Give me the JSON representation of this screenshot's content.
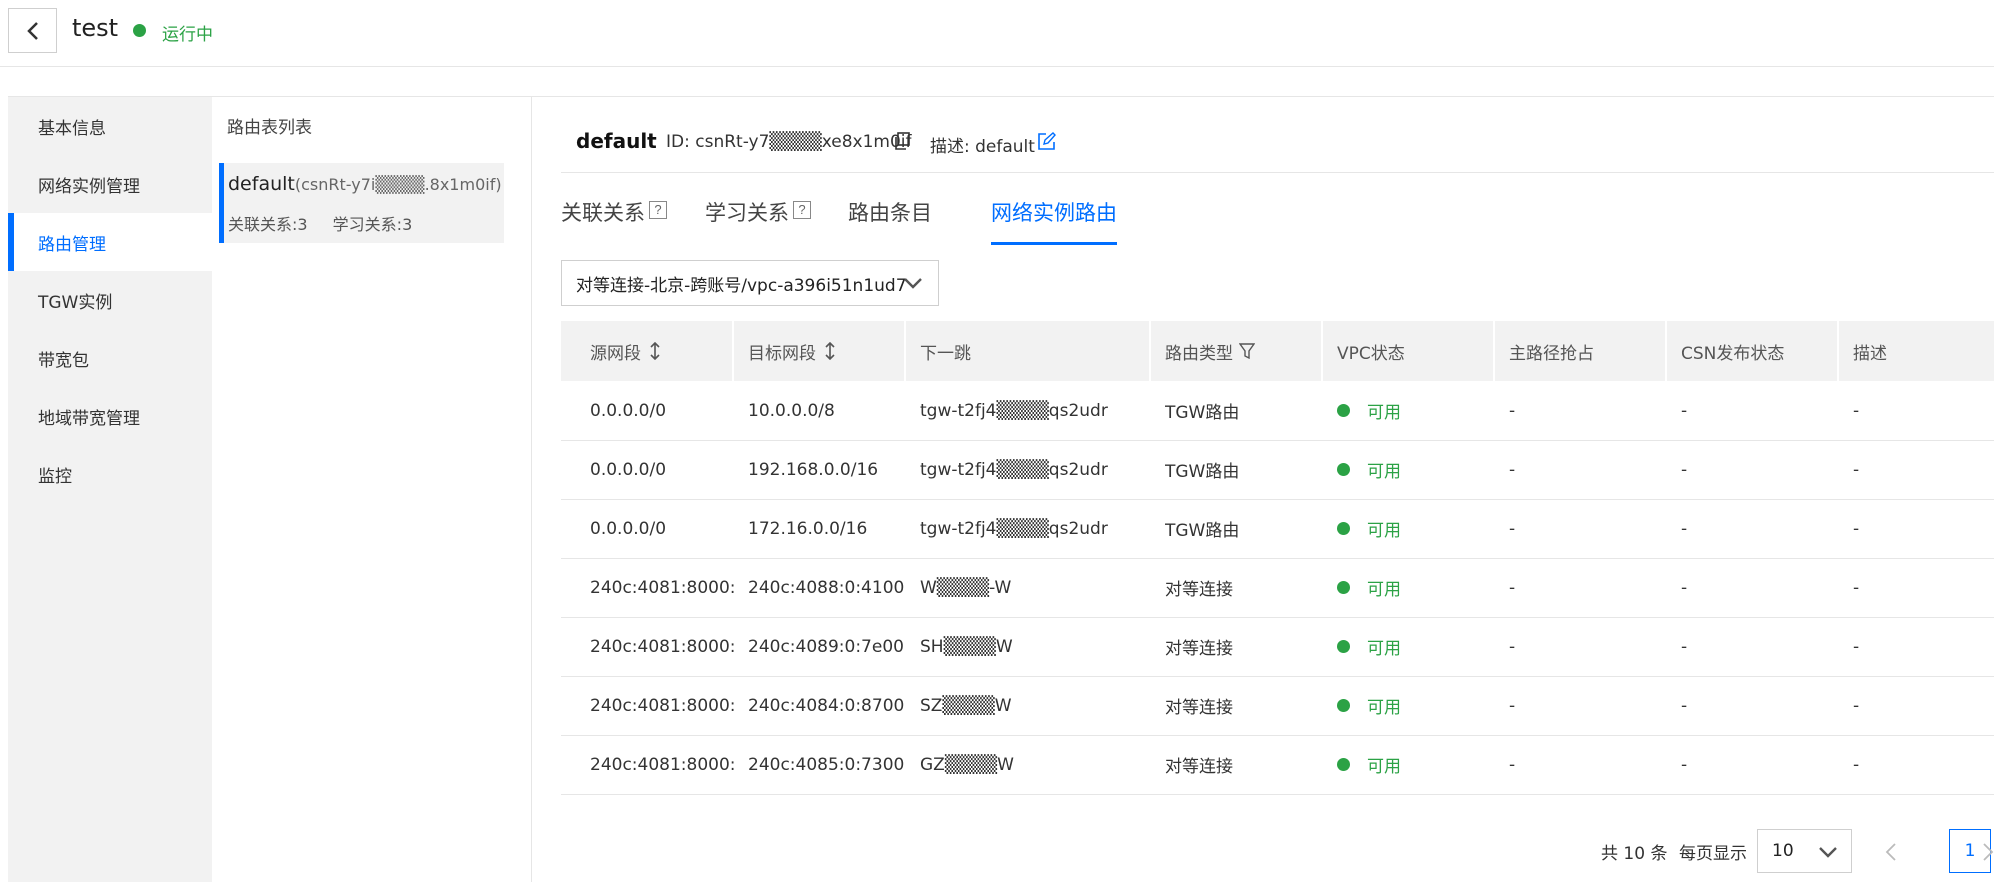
{
  "header": {
    "title": "test",
    "status": "运行中",
    "status_color": "#2ba245"
  },
  "nav": {
    "items": [
      {
        "label": "基本信息"
      },
      {
        "label": "网络实例管理"
      },
      {
        "label": "路由管理",
        "active": true
      },
      {
        "label": "TGW实例"
      },
      {
        "label": "带宽包"
      },
      {
        "label": "地域带宽管理"
      },
      {
        "label": "监控"
      }
    ]
  },
  "route_tables": {
    "title": "路由表列表",
    "items": [
      {
        "name": "default",
        "id": "(csnRt-y7i▒▒▒▒.8x1m0if)",
        "associations": "关联关系:3",
        "learnings": "学习关系:3"
      }
    ]
  },
  "detail": {
    "name": "default",
    "id_text": "ID: csnRt-y7▒▒▒▒xe8x1m0if",
    "desc_text": "描述: default",
    "icons": {
      "copy": "copy-icon",
      "edit": "edit-icon"
    }
  },
  "tabs": [
    {
      "label": "关联关系",
      "help": true
    },
    {
      "label": "学习关系",
      "help": true
    },
    {
      "label": "路由条目",
      "help": false
    },
    {
      "label": "网络实例路由",
      "help": false,
      "active": true
    }
  ],
  "instance_select": {
    "value": "对等连接-北京-跨账号/vpc-a396i51n1ud7"
  },
  "table": {
    "columns": [
      "源网段",
      "目标网段",
      "下一跳",
      "路由类型",
      "VPC状态",
      "主路径抢占",
      "CSN发布状态",
      "描述"
    ],
    "rows": [
      [
        "0.0.0.0/0",
        "10.0.0.0/8",
        "tgw-t2fj4▒▒▒▒qs2udr",
        "TGW路由",
        "可用",
        "-",
        "-",
        "-"
      ],
      [
        "0.0.0.0/0",
        "192.168.0.0/16",
        "tgw-t2fj4▒▒▒▒qs2udr",
        "TGW路由",
        "可用",
        "-",
        "-",
        "-"
      ],
      [
        "0.0.0.0/0",
        "172.16.0.0/16",
        "tgw-t2fj4▒▒▒▒qs2udr",
        "TGW路由",
        "可用",
        "-",
        "-",
        "-"
      ],
      [
        "240c:4081:8000:",
        "240c:4088:0:4100",
        "W▒▒▒▒-W",
        "对等连接",
        "可用",
        "-",
        "-",
        "-"
      ],
      [
        "240c:4081:8000:",
        "240c:4089:0:7e00",
        "SH▒▒▒▒W",
        "对等连接",
        "可用",
        "-",
        "-",
        "-"
      ],
      [
        "240c:4081:8000:",
        "240c:4084:0:8700",
        "SZ▒▒▒▒W",
        "对等连接",
        "可用",
        "-",
        "-",
        "-"
      ],
      [
        "240c:4081:8000:",
        "240c:4085:0:7300",
        "GZ▒▒▒▒W",
        "对等连接",
        "可用",
        "-",
        "-",
        "-"
      ]
    ]
  },
  "pagination": {
    "total": "共 10 条",
    "page_size_label": "每页显示",
    "page_size": "10",
    "current_page": "1"
  },
  "colors": {
    "accent": "#006eff",
    "success": "#2ba245"
  }
}
